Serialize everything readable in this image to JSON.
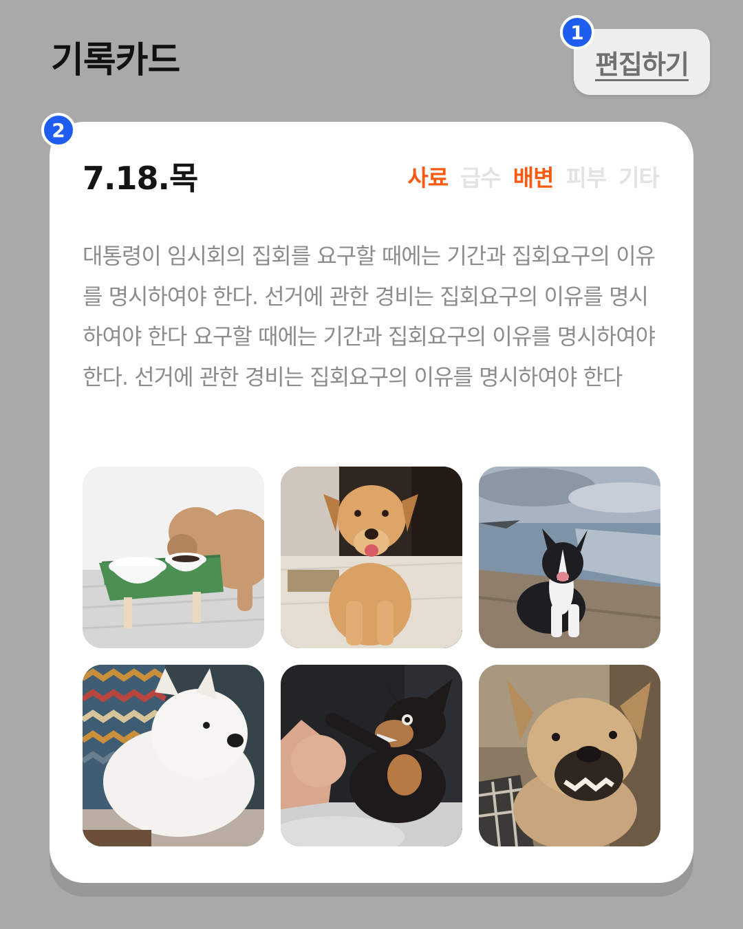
{
  "header": {
    "title": "기록카드",
    "edit_label": "편집하기"
  },
  "markers": {
    "one": "1",
    "two": "2"
  },
  "card": {
    "date": "7.18.목",
    "tags": [
      {
        "label": "사료",
        "active": true
      },
      {
        "label": "급수",
        "active": false
      },
      {
        "label": "배변",
        "active": true
      },
      {
        "label": "피부",
        "active": false
      },
      {
        "label": "기타",
        "active": false
      }
    ],
    "body": "대통령이 임시회의 집회를 요구할 때에는 기간과 집회요구의 이유를 명시하여야 한다. 선거에 관한 경비는 집회요구의 이유를 명시하여야 한다 요구할 때에는 기간과 집회요구의 이유를 명시하여야 한다. 선거에 관한 경비는 집회요구의 이유를 명시하여야 한다",
    "photos": [
      {
        "name": "poodle-eating-photo"
      },
      {
        "name": "smiling-dog-photo"
      },
      {
        "name": "border-collie-seaside-photo"
      },
      {
        "name": "westie-photo"
      },
      {
        "name": "chihuahua-growling-photo"
      },
      {
        "name": "snarling-dog-photo"
      }
    ]
  },
  "colors": {
    "background": "#a9a9a9",
    "card": "#ffffff",
    "accent": "#fb5a10",
    "inactive_tag": "#e3e3e3",
    "marker": "#1f5cf0",
    "body_text": "#8c8c8c"
  }
}
